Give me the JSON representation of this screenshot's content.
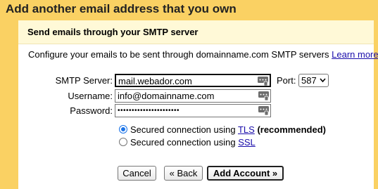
{
  "header": {
    "title": "Add another email address that you own"
  },
  "section": {
    "heading": "Send emails through your SMTP server"
  },
  "description": {
    "text": "Configure your emails to be sent through domainname.com SMTP servers",
    "link": "Learn more"
  },
  "form": {
    "smtp_label": "SMTP Server:",
    "smtp_value": "mail.webador.com",
    "port_label": "Port:",
    "port_value": "587",
    "username_label": "Username:",
    "username_value": "info@domainname.com",
    "password_label": "Password:",
    "password_value": "••••••••••••••••••••••"
  },
  "security": {
    "tls": {
      "prefix": "Secured connection using ",
      "link": "TLS",
      "suffix": " (recommended)",
      "selected": true
    },
    "ssl": {
      "prefix": "Secured connection using ",
      "link": "SSL",
      "selected": false
    }
  },
  "buttons": {
    "cancel": "Cancel",
    "back": "« Back",
    "add": "Add Account »"
  },
  "colors": {
    "header_bg": "#fad163",
    "subheader_bg": "#fff9d7",
    "link": "#1a0dab",
    "radio_accent": "#1a73e8"
  }
}
